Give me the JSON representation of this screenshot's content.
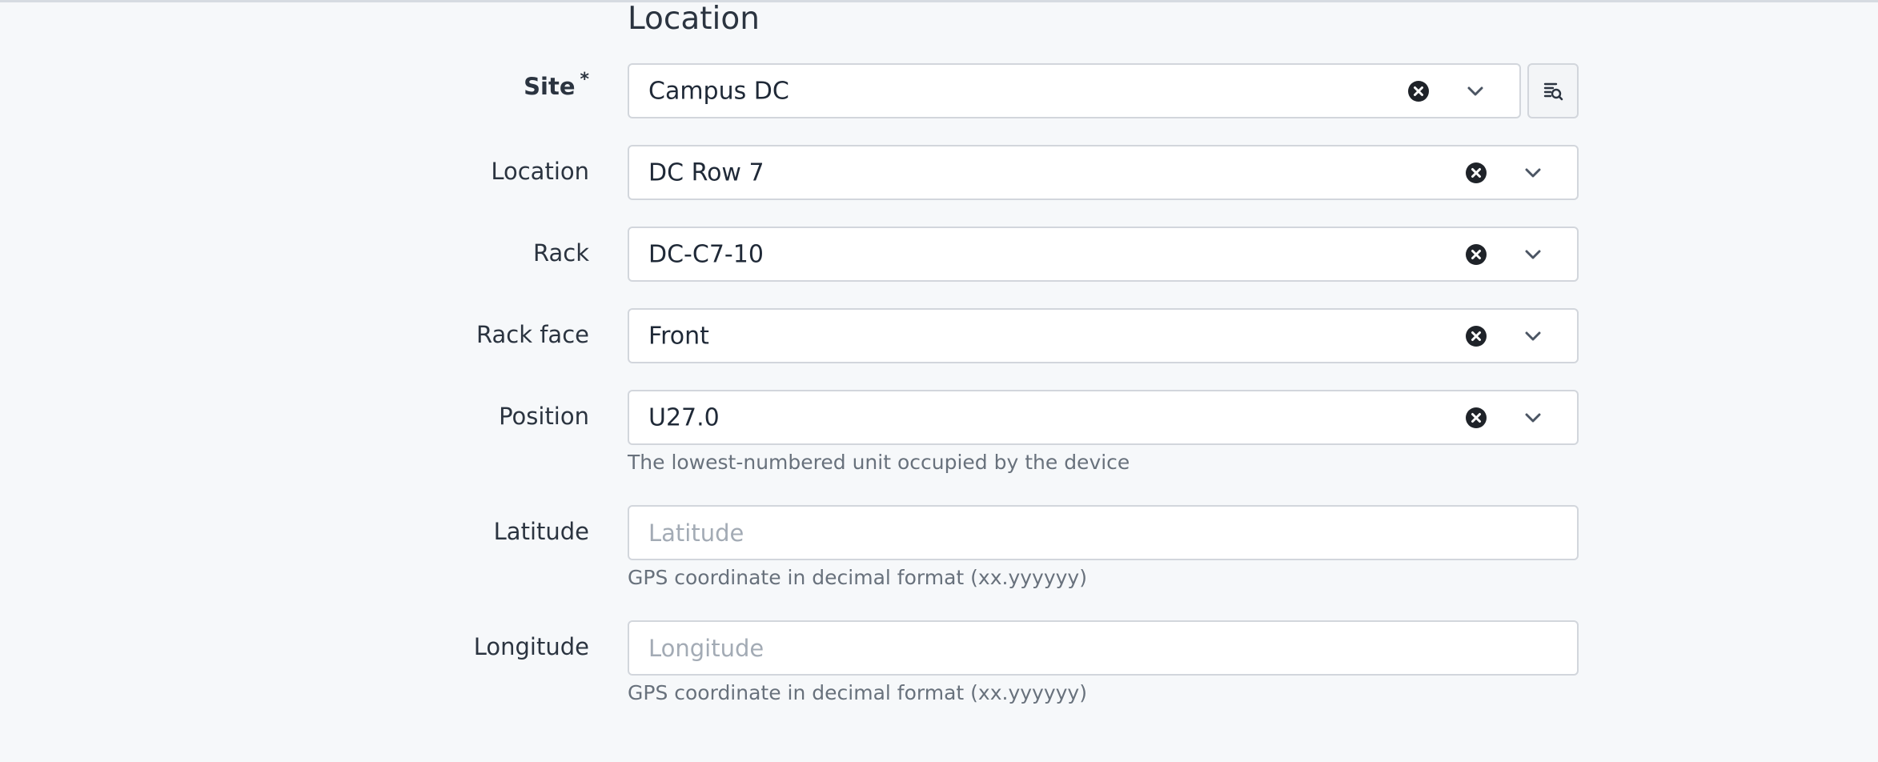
{
  "section": {
    "title": "Location"
  },
  "fields": {
    "site": {
      "label": "Site",
      "required_mark": "*",
      "value": "Campus DC"
    },
    "location": {
      "label": "Location",
      "value": "DC Row 7"
    },
    "rack": {
      "label": "Rack",
      "value": "DC-C7-10"
    },
    "rack_face": {
      "label": "Rack face",
      "value": "Front"
    },
    "position": {
      "label": "Position",
      "value": "U27.0",
      "help": "The lowest-numbered unit occupied by the device"
    },
    "latitude": {
      "label": "Latitude",
      "value": "",
      "placeholder": "Latitude",
      "help": "GPS coordinate in decimal format (xx.yyyyyy)"
    },
    "longitude": {
      "label": "Longitude",
      "value": "",
      "placeholder": "Longitude",
      "help": "GPS coordinate in decimal format (xx.yyyyyy)"
    }
  },
  "icons": {
    "clear": "clear-circle-x-icon",
    "dropdown": "chevron-down-icon",
    "selector": "object-selector-icon"
  },
  "colors": {
    "background": "#f6f8fa",
    "field_border": "#d2d6dc",
    "text": "#1f2937",
    "muted": "#68717c"
  }
}
